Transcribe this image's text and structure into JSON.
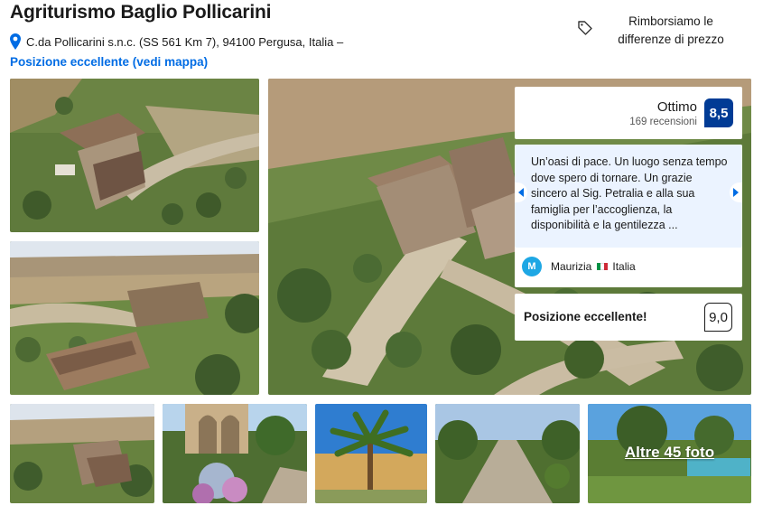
{
  "header": {
    "title": "Agriturismo Baglio Pollicarini",
    "address": "C.da Pollicarini s.n.c. (SS 561 Km 7), 94100 Pergusa, Italia –",
    "map_link": "Posizione eccellente (vedi mappa)",
    "price_match": "Rimborsiamo le differenze di prezzo"
  },
  "review_panel": {
    "score_word": "Ottimo",
    "review_count": "169 recensioni",
    "score": "8,5",
    "quote": "Un’oasi di pace. Un luogo senza tempo dove spero di tornare. Un grazie sincero al Sig. Petralia e alla sua famiglia per l’accoglienza, la disponibilità e la gentilezza ...",
    "reviewer_initial": "M",
    "reviewer_name": "Maurizia",
    "reviewer_country": "Italia",
    "location_label": "Posizione eccellente!",
    "location_score": "9,0"
  },
  "gallery": {
    "more_photos": "Altre 45 foto"
  },
  "colors": {
    "brand_blue": "#003b95",
    "link_blue": "#006ce4",
    "quote_bg": "#ebf3ff",
    "avatar": "#1ea7e4"
  },
  "icons": [
    "map-pin-icon",
    "price-tag-icon",
    "chevron-left-icon",
    "chevron-right-icon",
    "italy-flag-icon"
  ]
}
